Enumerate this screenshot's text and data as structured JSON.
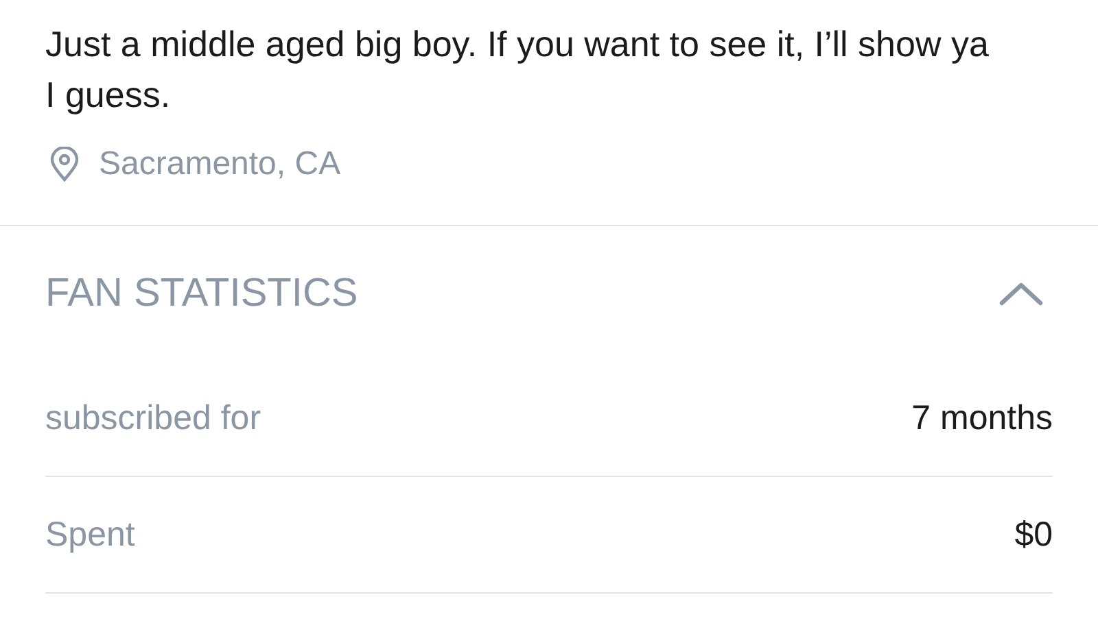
{
  "bio": {
    "text": "Just a middle aged big boy. If you want to see it, I’ll show ya I guess.",
    "location": "Sacramento, CA"
  },
  "fan_statistics": {
    "title": "FAN STATISTICS",
    "expanded": true,
    "rows": [
      {
        "label": "subscribed for",
        "value": "7 months"
      },
      {
        "label": "Spent",
        "value": "$0"
      }
    ]
  }
}
